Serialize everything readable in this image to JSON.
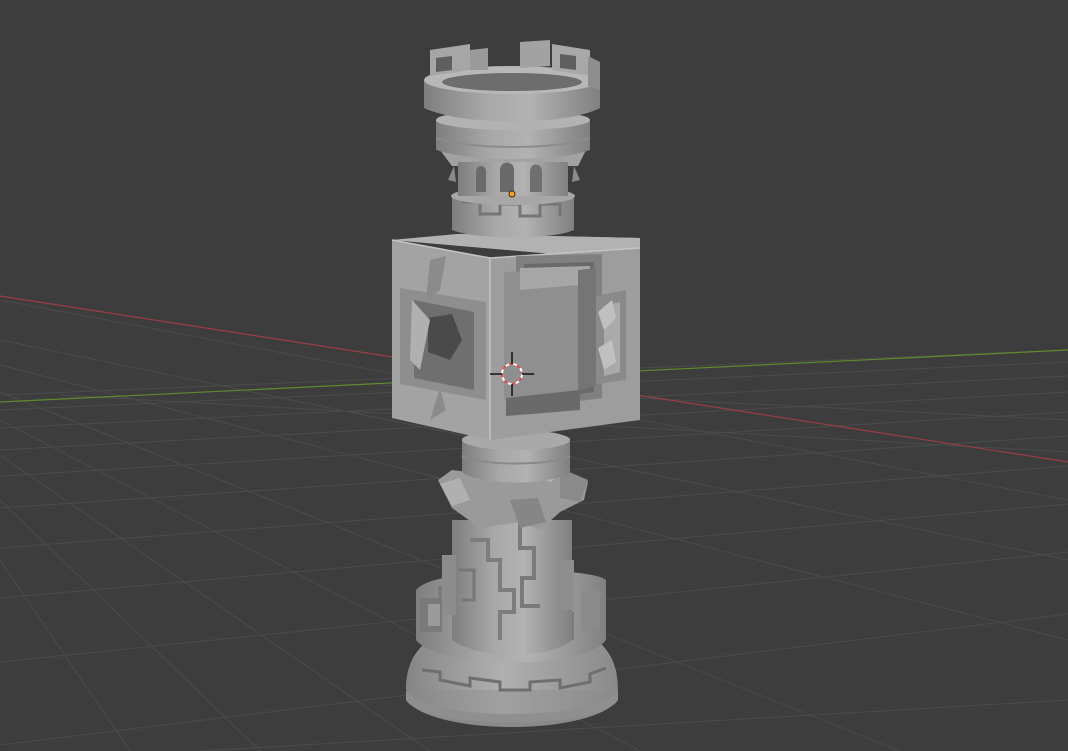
{
  "viewport": {
    "background_color": "#3d3d3d",
    "grid_line_color": "#4a4a4a",
    "x_axis_color": "#b4444c",
    "y_axis_color": "#6a9432",
    "model_color": "#9e9e9e",
    "model_shadow_color": "#7e7e7e",
    "model_highlight_color": "#b5b5b5",
    "origin_marker_color": "#ff9e1a",
    "cursor_color_a": "#e84a4a",
    "cursor_color_b": "#ffffff"
  },
  "scene": {
    "object": "rook-chess-piece",
    "icons": [
      "3d-cursor-icon",
      "object-origin-icon"
    ]
  }
}
